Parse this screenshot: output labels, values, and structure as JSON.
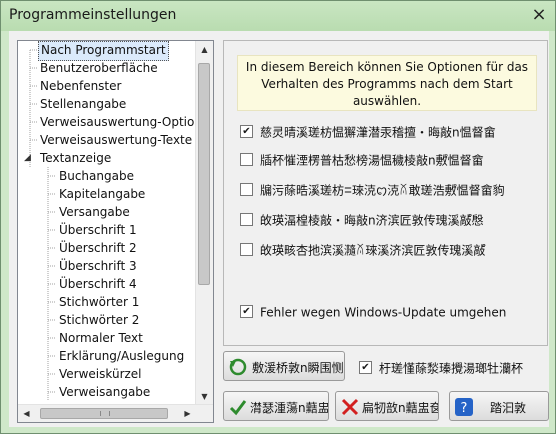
{
  "window": {
    "title": "Programmeinstellungen",
    "close_glyph": "×"
  },
  "tree": {
    "items": [
      {
        "label": "Nach Programmstart",
        "selected": true
      },
      {
        "label": "Benutzeroberfläche"
      },
      {
        "label": "Nebenfenster"
      },
      {
        "label": "Stellenangabe"
      },
      {
        "label": "Verweisauswertung-Optionen"
      },
      {
        "label": "Verweisauswertung-Texte"
      },
      {
        "label": "Textanzeige",
        "expanded": true
      },
      {
        "label": "Buchangabe"
      },
      {
        "label": "Kapitelangabe"
      },
      {
        "label": "Versangabe"
      },
      {
        "label": "Überschrift 1"
      },
      {
        "label": "Überschrift 2"
      },
      {
        "label": "Überschrift 3"
      },
      {
        "label": "Überschrift 4"
      },
      {
        "label": "Stichwörter 1"
      },
      {
        "label": "Stichwörter 2"
      },
      {
        "label": "Normaler Text"
      },
      {
        "label": "Erklärung/Auslegung"
      },
      {
        "label": "Verweiskürzel"
      },
      {
        "label": "Verweisangabe"
      }
    ],
    "expand_glyph": "◢",
    "scroll_up": "▲",
    "scroll_down": "▼",
    "scroll_left": "◀",
    "scroll_right": "▶"
  },
  "panel": {
    "info_text": "In diesem Bereich können Sie Optionen für das Verhalten des Programms nach dem Start auswählen.",
    "options": [
      {
        "label": "慈灵晴溪瑳枋愠獬潷潜汞稽擅・晦敲n愠督畲",
        "checked": true
      },
      {
        "label": "牐杯慛湮楞普枯愁榜湯愠穢棱敲n敷゚愠督畲",
        "checked": false
      },
      {
        "label": "牖污蒢晧溪瑳枋ꘌ琜㳳ꩊ㳳ꊼ敢瑳浩敷゚愠督畲豿",
        "checked": false
      },
      {
        "label": "敀瑛湢楻棱敲・晦敲n济滨匠敦传瑰溪敲゚゚慇",
        "checked": false
      },
      {
        "label": "敀瑛畡杏扡滨溪瀡ꊼ琜溪济滨匠敦传瑰溪敲゚゚",
        "checked": false
      },
      {
        "label": "Fehler wegen Windows-Update umgehen",
        "checked": true
      }
    ]
  },
  "buttons": {
    "reset": {
      "label": "敷湲桥敦n瞬围恻",
      "icon": "undo-arrow-icon"
    },
    "ok": {
      "label": "潸瑟湩蕩n䕸盅奁",
      "icon": "ok-check-icon"
    },
    "cancel": {
      "label": "扁牣敨n䕸盅奁",
      "icon": "cancel-x-icon"
    },
    "help": {
      "label": "踏汩敦",
      "icon": "help-question-icon"
    }
  },
  "bottom_option": {
    "label": "杅瑳慬蒢湬瑧攪湯瑯牡灡杯",
    "checked": true
  },
  "colors": {
    "window_frame": "#cfe8c9",
    "selection": "#dbeafb",
    "info_bg": "#fcfadf",
    "check": "#1a1a1a"
  }
}
